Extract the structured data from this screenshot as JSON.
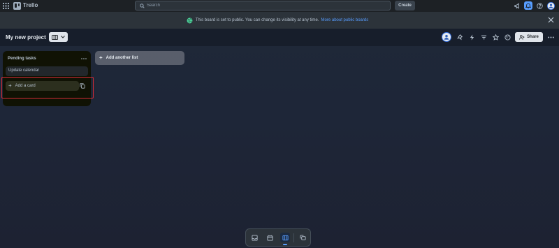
{
  "header": {
    "brand": "Trello",
    "search_placeholder": "Search",
    "create_label": "Create"
  },
  "banner": {
    "message": "This board is set to public. You can change its visibility at any time.",
    "link": "More about public boards"
  },
  "board": {
    "title": "My new project",
    "share_label": "Share"
  },
  "lists": [
    {
      "title": "Pending tasks",
      "cards": [
        "Update calendar"
      ],
      "add_card_label": "Add a card"
    }
  ],
  "add_list_label": "Add another list",
  "view_switcher": {
    "items": [
      "inbox-icon",
      "calendar-icon",
      "board-icon",
      "switch-boards-icon"
    ],
    "active": "board-icon"
  },
  "colors": {
    "accent": "#579dff",
    "list_background": "#101204",
    "highlight": "#d42b35"
  }
}
